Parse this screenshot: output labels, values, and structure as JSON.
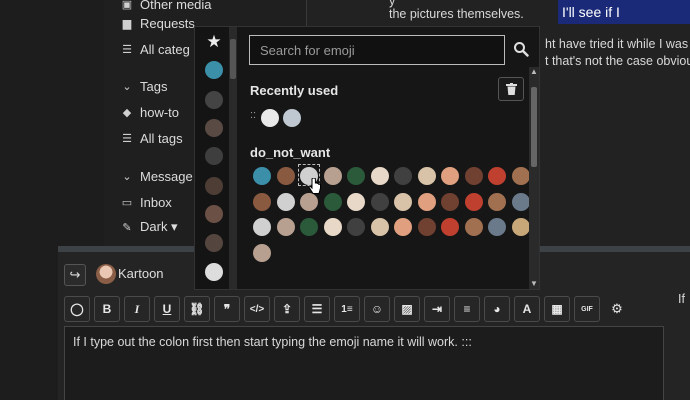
{
  "sidebar": {
    "items": [
      {
        "label": "Other media",
        "icon": "image-icon"
      },
      {
        "label": "Requests",
        "icon": "lock-icon"
      },
      {
        "label": "All categ",
        "icon": "list-icon"
      },
      {
        "label": "Tags",
        "icon": "chevron-down-icon"
      },
      {
        "label": "how-to",
        "icon": "tag-icon"
      },
      {
        "label": "All tags",
        "icon": "list-icon"
      },
      {
        "label": "Message",
        "icon": "chevron-down-icon"
      },
      {
        "label": "Inbox",
        "icon": "inbox-icon"
      },
      {
        "label": "Dark ▾",
        "icon": "brush-icon"
      }
    ]
  },
  "post": {
    "lines_left": [
      "y",
      "the pictures themselves."
    ],
    "lines_right": [
      "ht have tried it while I was",
      "t that's not the case obviou"
    ],
    "highlight": "I'll see if I"
  },
  "picker": {
    "search_placeholder": "Search for emoji",
    "recent_title": "Recently used",
    "recent_colons": "::",
    "section_title": "do_not_want"
  },
  "composer": {
    "username": "Kartoon",
    "editor_text": "If I type out the colon first then start typing the emoji name it will work. :::",
    "side_text": "If",
    "skin_tones": [
      "#ffcc33",
      "#6b3a1f",
      "#8a5a2b",
      "#b07a45",
      "#c98d5e",
      "#9c6a55"
    ]
  },
  "colors": {
    "background": "#1c1c1c",
    "highlight": "#1a2a78",
    "composer_border": "#3c4246"
  }
}
